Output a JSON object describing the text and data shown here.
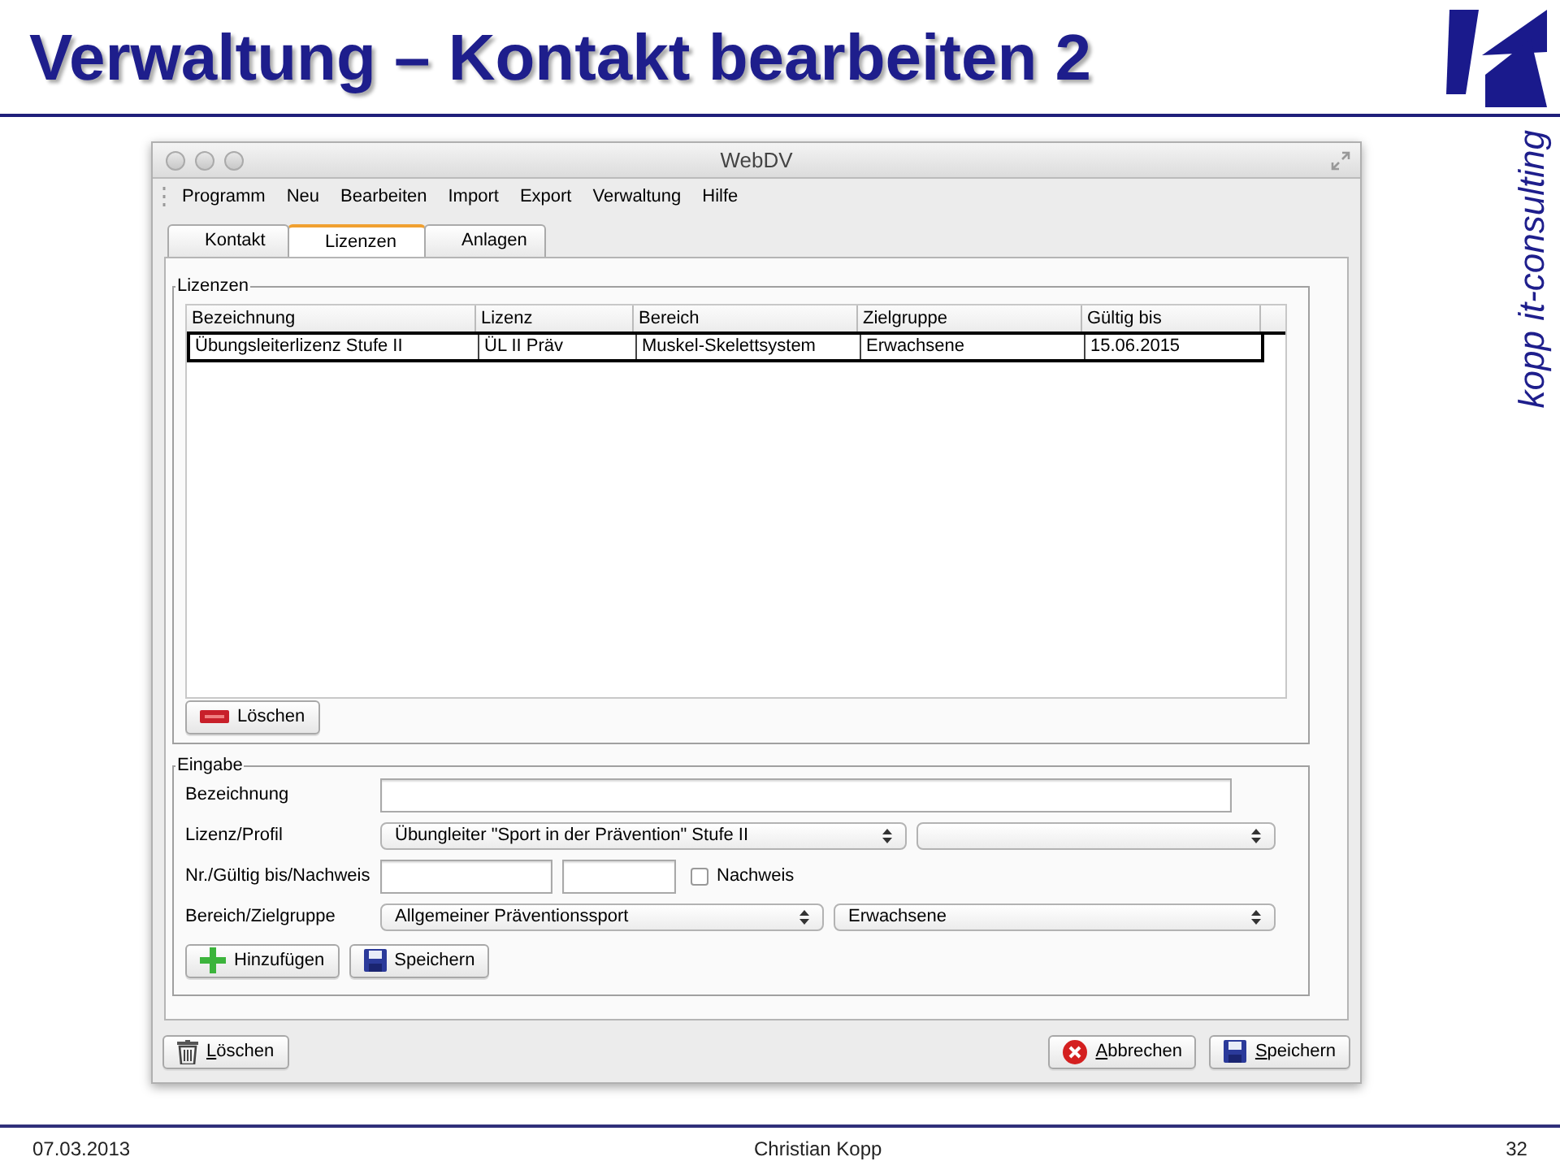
{
  "slide": {
    "title": "Verwaltung – Kontakt bearbeiten 2",
    "side_text": "kopp it-consulting"
  },
  "window": {
    "title": "WebDV",
    "menu": [
      "Programm",
      "Neu",
      "Bearbeiten",
      "Import",
      "Export",
      "Verwaltung",
      "Hilfe"
    ],
    "tabs": [
      {
        "label": "Kontakt",
        "selected": false
      },
      {
        "label": "Lizenzen",
        "selected": true
      },
      {
        "label": "Anlagen",
        "selected": false
      }
    ],
    "lizenzen": {
      "title": "Lizenzen",
      "columns": [
        "Bezeichnung",
        "Lizenz",
        "Bereich",
        "Zielgruppe",
        "Gültig bis"
      ],
      "rows": [
        {
          "cells": [
            "Übungsleiterlizenz Stufe II",
            "ÜL II Präv",
            "Muskel-Skelettsystem",
            "Erwachsene",
            "15.06.2015"
          ],
          "selected": true
        }
      ],
      "button": {
        "kind": "remove",
        "label": "Löschen"
      }
    },
    "eingabe": {
      "title": "Eingabe",
      "rows": [
        {
          "label": "Bezeichnung",
          "controls": [
            {
              "kind": "input"
            }
          ]
        },
        {
          "label": "Lizenz/Profil",
          "controls": [
            {
              "kind": "select",
              "value": "Übungleiter \"Sport in der Prävention\" Stufe II"
            },
            {
              "kind": "select"
            }
          ]
        },
        {
          "label": "Nr./Gültig bis/Nachweis",
          "controls": [
            {
              "kind": "input"
            },
            {
              "kind": "input"
            },
            {
              "kind": "checkbox",
              "label": "Nachweis",
              "checked": false
            }
          ]
        },
        {
          "label": "Bereich/Zielgruppe",
          "controls": [
            {
              "kind": "select",
              "value": "Allgemeiner Präventionssport"
            },
            {
              "kind": "select",
              "value": "Erwachsene"
            }
          ]
        }
      ],
      "buttons": [
        {
          "kind": "add",
          "label": "Hinzufügen"
        },
        {
          "kind": "save",
          "label": "Speichern"
        }
      ]
    },
    "footer_left": [
      {
        "kind": "trash",
        "label": "Löschen"
      }
    ],
    "footer_right": [
      {
        "kind": "cancel",
        "label": "Abbrechen"
      },
      {
        "kind": "save",
        "label": "Speichern"
      }
    ]
  },
  "footer": {
    "date": "07.03.2013",
    "author": "Christian Kopp",
    "page": "32"
  }
}
